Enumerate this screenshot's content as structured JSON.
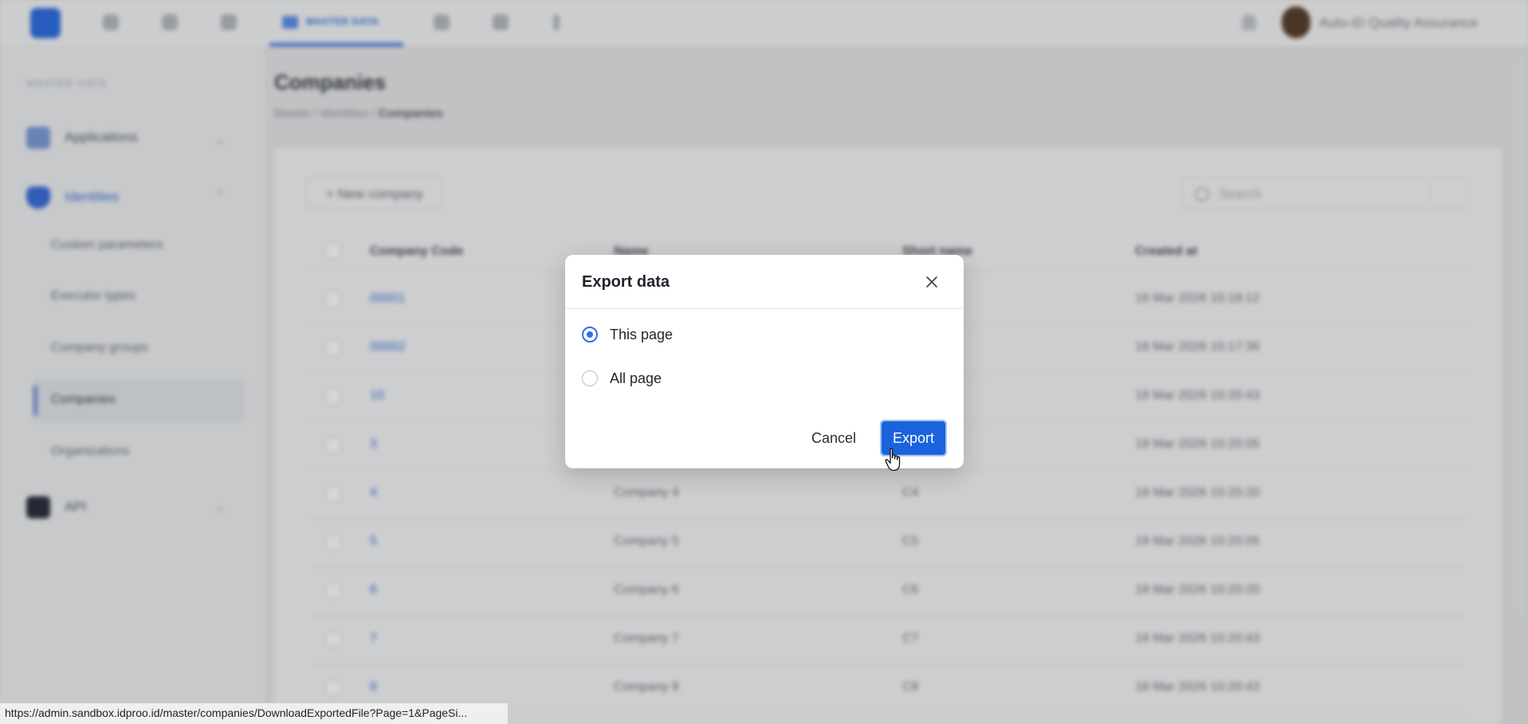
{
  "topnav": {
    "active_tab": "MASTER DATA",
    "user_name": "Auto-ID Quality Assurance"
  },
  "sidebar": {
    "section_title": "MASTER DATA",
    "groups": [
      {
        "label": "Applications"
      },
      {
        "label": "Identities"
      },
      {
        "label": "API"
      }
    ],
    "sub_items": [
      {
        "label": "Custom parameters"
      },
      {
        "label": "Executor types"
      },
      {
        "label": "Company groups"
      },
      {
        "label": "Companies"
      },
      {
        "label": "Organizations"
      }
    ]
  },
  "page": {
    "title": "Companies",
    "breadcrumb": [
      "Master",
      "Identities",
      "Companies"
    ],
    "new_button": "+ New company",
    "search_placeholder": "Search"
  },
  "table": {
    "columns": [
      "Company Code",
      "Name",
      "Short name",
      "Created at"
    ],
    "rows": [
      {
        "code": "00001",
        "name": "",
        "short": "",
        "created": "18 Mar 2026 10:18:12"
      },
      {
        "code": "00002",
        "name": "",
        "short": "",
        "created": "18 Mar 2026 10:17:36"
      },
      {
        "code": "10",
        "name": "",
        "short": "",
        "created": "18 Mar 2026 10:20:43"
      },
      {
        "code": "3",
        "name": "",
        "short": "",
        "created": "18 Mar 2026 10:20:05"
      },
      {
        "code": "4",
        "name": "Company 4",
        "short": "C4",
        "created": "18 Mar 2026 10:20:20"
      },
      {
        "code": "5",
        "name": "Company 5",
        "short": "C5",
        "created": "18 Mar 2026 10:20:05"
      },
      {
        "code": "6",
        "name": "Company 6",
        "short": "C6",
        "created": "18 Mar 2026 10:20:20"
      },
      {
        "code": "7",
        "name": "Company 7",
        "short": "C7",
        "created": "18 Mar 2026 10:20:43"
      },
      {
        "code": "8",
        "name": "Company 8",
        "short": "C8",
        "created": "18 Mar 2026 10:20:43"
      }
    ]
  },
  "modal": {
    "title": "Export data",
    "options": [
      {
        "label": "This page",
        "selected": true
      },
      {
        "label": "All page",
        "selected": false
      }
    ],
    "cancel_label": "Cancel",
    "export_label": "Export"
  },
  "status_url": "https://admin.sandbox.idproo.id/master/companies/DownloadExportedFile?Page=1&PageSi...",
  "colors": {
    "accent": "#1a63dd",
    "radio_selected": "#2e6ee8"
  },
  "icons": [
    "app-logo-icon",
    "bell-icon",
    "close-icon",
    "search-icon",
    "cursor-hand-icon"
  ]
}
